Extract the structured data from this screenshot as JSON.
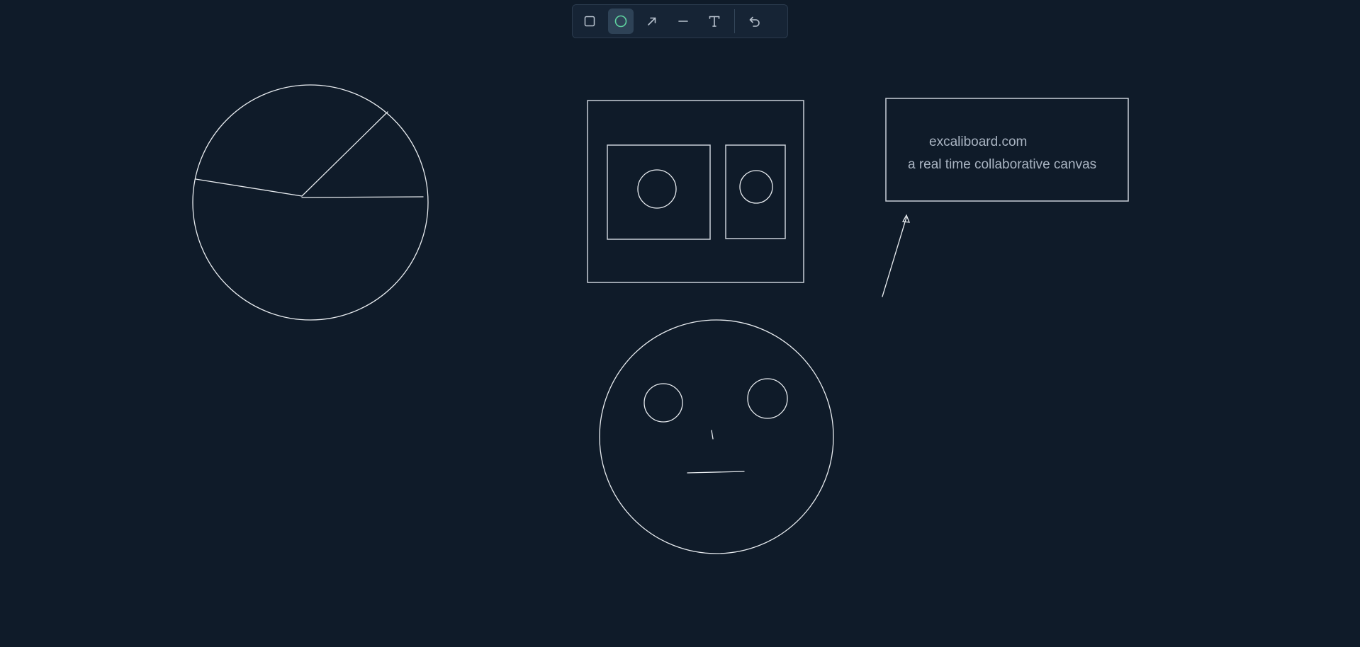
{
  "toolbar": {
    "tools": [
      {
        "name": "rectangle-tool",
        "icon": "square-icon",
        "active": false
      },
      {
        "name": "ellipse-tool",
        "icon": "circle-icon",
        "active": true
      },
      {
        "name": "arrow-tool",
        "icon": "arrow-icon",
        "active": false
      },
      {
        "name": "line-tool",
        "icon": "line-icon",
        "active": false
      },
      {
        "name": "text-tool",
        "icon": "text-icon",
        "active": false
      },
      {
        "name": "undo-button",
        "icon": "undo-icon",
        "active": false
      }
    ],
    "colors": {
      "accent": "#5fd3a0",
      "icon": "#b9c3cf",
      "active_bg": "#2e4256"
    }
  },
  "canvas": {
    "background": "#0f1b29",
    "stroke_color": "#e8ecf0",
    "text_color": "#a9b4c2",
    "text_box": {
      "line1": "excaliboard.com",
      "line2": "a real time collaborative canvas"
    }
  }
}
